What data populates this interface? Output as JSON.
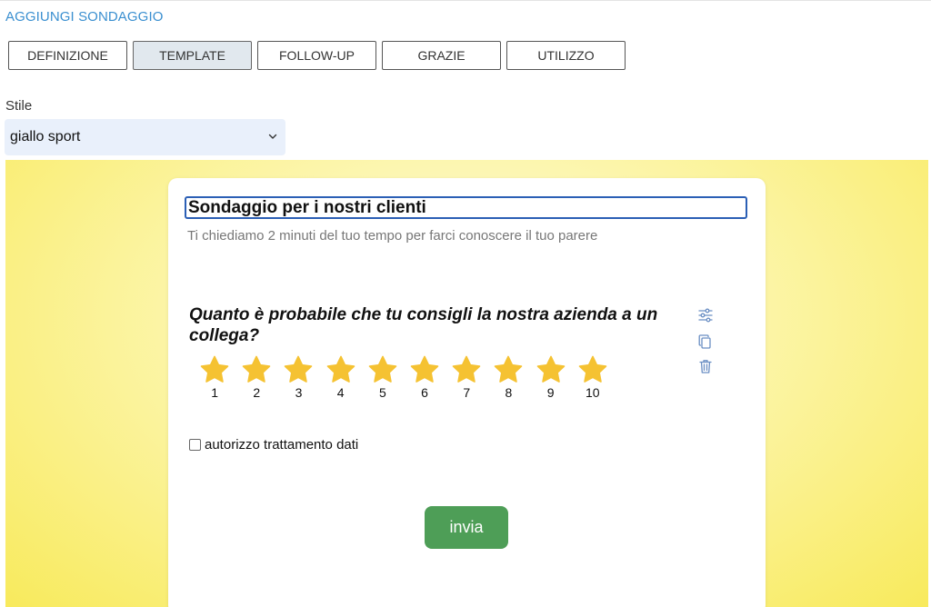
{
  "header": {
    "title": "AGGIUNGI SONDAGGIO"
  },
  "tabs": [
    {
      "label": "DEFINIZIONE",
      "active": false
    },
    {
      "label": "TEMPLATE",
      "active": true
    },
    {
      "label": "FOLLOW-UP",
      "active": false
    },
    {
      "label": "GRAZIE",
      "active": false
    },
    {
      "label": "UTILIZZO",
      "active": false
    }
  ],
  "style": {
    "label": "Stile",
    "selected": "giallo sport"
  },
  "survey": {
    "title": "Sondaggio per i nostri clienti",
    "subtitle": "Ti chiediamo 2 minuti del tuo tempo per farci conoscere il tuo parere",
    "question": "Quanto è probabile che tu consigli la nostra azienda a un collega?",
    "rating": [
      "1",
      "2",
      "3",
      "4",
      "5",
      "6",
      "7",
      "8",
      "9",
      "10"
    ],
    "consent_label": "autorizzo trattamento dati",
    "submit_label": "invia",
    "tools": [
      "sliders-icon",
      "copy-icon",
      "trash-icon"
    ]
  },
  "colors": {
    "accent": "#3a8fd0",
    "star": "#f5c232",
    "submit": "#4e9e57",
    "background": "#f8ea5c"
  }
}
